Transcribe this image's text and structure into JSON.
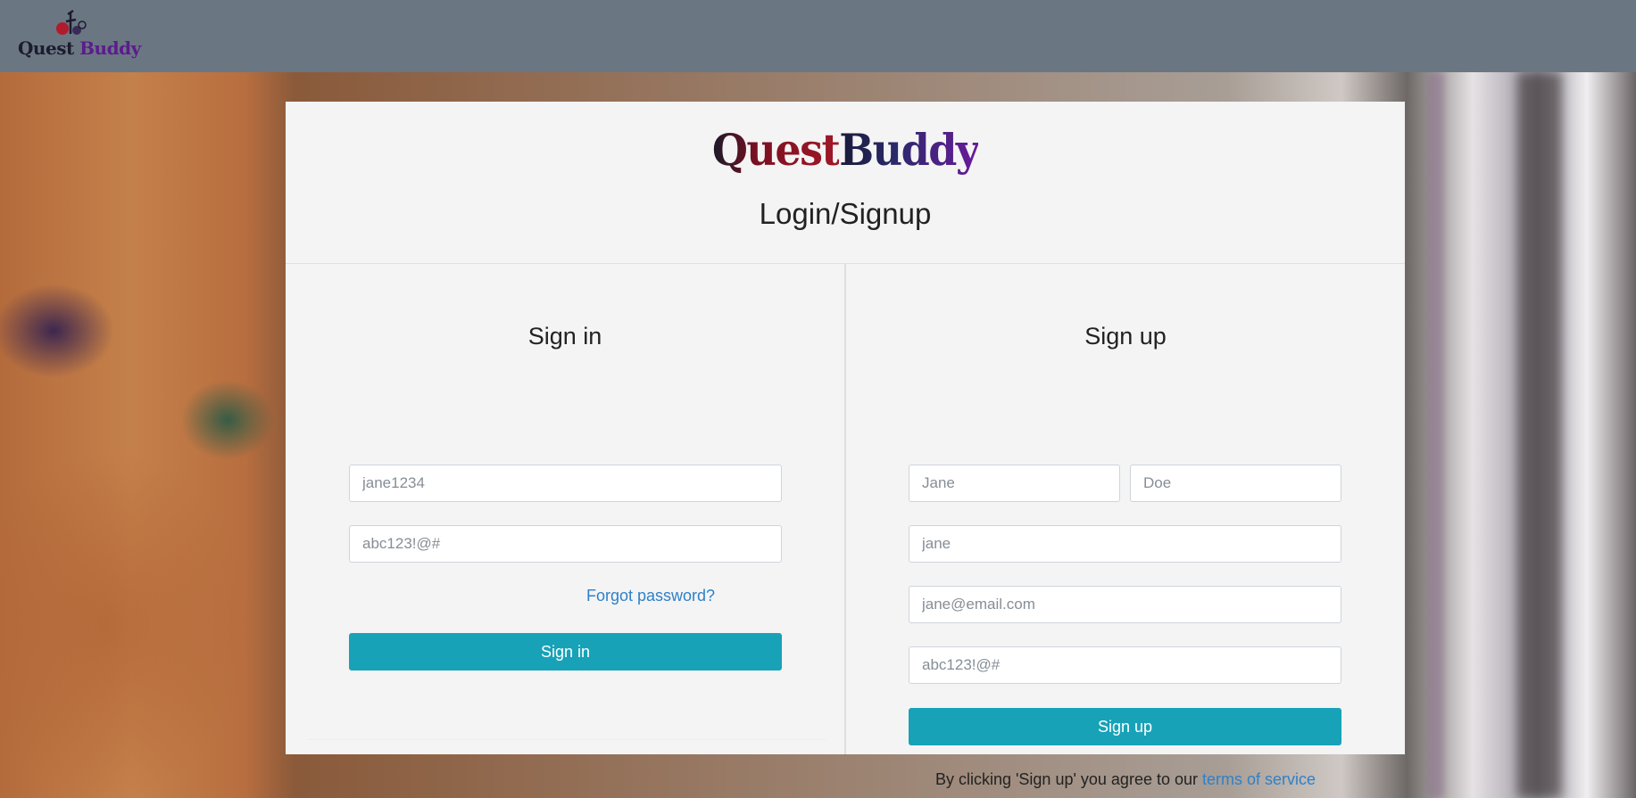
{
  "nav": {
    "logo_text_part1": "Quest",
    "logo_text_part2": "Buddy"
  },
  "header": {
    "brand_part1": "Quest",
    "brand_part2": "Buddy",
    "title": "Login/Signup"
  },
  "signin": {
    "title": "Sign in",
    "username_placeholder": "jane1234",
    "password_placeholder": "abc123!@#",
    "forgot_link": "Forgot password?",
    "button_label": "Sign in"
  },
  "signup": {
    "title": "Sign up",
    "first_name_placeholder": "Jane",
    "last_name_placeholder": "Doe",
    "username_placeholder": "jane",
    "email_placeholder": "jane@email.com",
    "password_placeholder": "abc123!@#",
    "button_label": "Sign up",
    "terms_prefix": "By clicking 'Sign up' you agree to our ",
    "terms_link": "terms of service"
  },
  "colors": {
    "navbar": "#6b7683",
    "card": "#f4f4f4",
    "primary_button": "#17a2b8",
    "link": "#2f80c9"
  }
}
